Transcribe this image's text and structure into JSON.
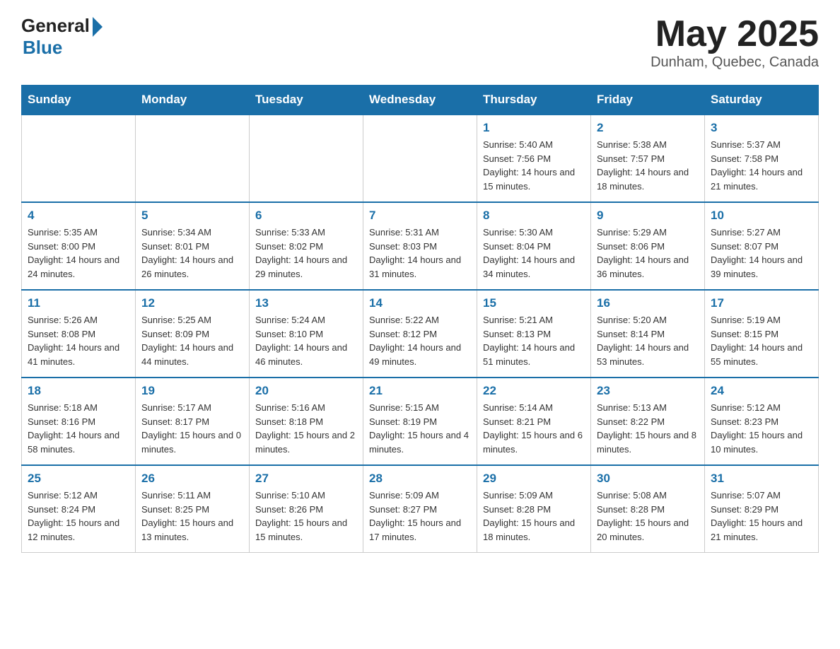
{
  "header": {
    "logo_general": "General",
    "logo_blue": "Blue",
    "title": "May 2025",
    "location": "Dunham, Quebec, Canada"
  },
  "weekdays": [
    "Sunday",
    "Monday",
    "Tuesday",
    "Wednesday",
    "Thursday",
    "Friday",
    "Saturday"
  ],
  "weeks": [
    [
      {
        "day": "",
        "info": ""
      },
      {
        "day": "",
        "info": ""
      },
      {
        "day": "",
        "info": ""
      },
      {
        "day": "",
        "info": ""
      },
      {
        "day": "1",
        "info": "Sunrise: 5:40 AM\nSunset: 7:56 PM\nDaylight: 14 hours and 15 minutes."
      },
      {
        "day": "2",
        "info": "Sunrise: 5:38 AM\nSunset: 7:57 PM\nDaylight: 14 hours and 18 minutes."
      },
      {
        "day": "3",
        "info": "Sunrise: 5:37 AM\nSunset: 7:58 PM\nDaylight: 14 hours and 21 minutes."
      }
    ],
    [
      {
        "day": "4",
        "info": "Sunrise: 5:35 AM\nSunset: 8:00 PM\nDaylight: 14 hours and 24 minutes."
      },
      {
        "day": "5",
        "info": "Sunrise: 5:34 AM\nSunset: 8:01 PM\nDaylight: 14 hours and 26 minutes."
      },
      {
        "day": "6",
        "info": "Sunrise: 5:33 AM\nSunset: 8:02 PM\nDaylight: 14 hours and 29 minutes."
      },
      {
        "day": "7",
        "info": "Sunrise: 5:31 AM\nSunset: 8:03 PM\nDaylight: 14 hours and 31 minutes."
      },
      {
        "day": "8",
        "info": "Sunrise: 5:30 AM\nSunset: 8:04 PM\nDaylight: 14 hours and 34 minutes."
      },
      {
        "day": "9",
        "info": "Sunrise: 5:29 AM\nSunset: 8:06 PM\nDaylight: 14 hours and 36 minutes."
      },
      {
        "day": "10",
        "info": "Sunrise: 5:27 AM\nSunset: 8:07 PM\nDaylight: 14 hours and 39 minutes."
      }
    ],
    [
      {
        "day": "11",
        "info": "Sunrise: 5:26 AM\nSunset: 8:08 PM\nDaylight: 14 hours and 41 minutes."
      },
      {
        "day": "12",
        "info": "Sunrise: 5:25 AM\nSunset: 8:09 PM\nDaylight: 14 hours and 44 minutes."
      },
      {
        "day": "13",
        "info": "Sunrise: 5:24 AM\nSunset: 8:10 PM\nDaylight: 14 hours and 46 minutes."
      },
      {
        "day": "14",
        "info": "Sunrise: 5:22 AM\nSunset: 8:12 PM\nDaylight: 14 hours and 49 minutes."
      },
      {
        "day": "15",
        "info": "Sunrise: 5:21 AM\nSunset: 8:13 PM\nDaylight: 14 hours and 51 minutes."
      },
      {
        "day": "16",
        "info": "Sunrise: 5:20 AM\nSunset: 8:14 PM\nDaylight: 14 hours and 53 minutes."
      },
      {
        "day": "17",
        "info": "Sunrise: 5:19 AM\nSunset: 8:15 PM\nDaylight: 14 hours and 55 minutes."
      }
    ],
    [
      {
        "day": "18",
        "info": "Sunrise: 5:18 AM\nSunset: 8:16 PM\nDaylight: 14 hours and 58 minutes."
      },
      {
        "day": "19",
        "info": "Sunrise: 5:17 AM\nSunset: 8:17 PM\nDaylight: 15 hours and 0 minutes."
      },
      {
        "day": "20",
        "info": "Sunrise: 5:16 AM\nSunset: 8:18 PM\nDaylight: 15 hours and 2 minutes."
      },
      {
        "day": "21",
        "info": "Sunrise: 5:15 AM\nSunset: 8:19 PM\nDaylight: 15 hours and 4 minutes."
      },
      {
        "day": "22",
        "info": "Sunrise: 5:14 AM\nSunset: 8:21 PM\nDaylight: 15 hours and 6 minutes."
      },
      {
        "day": "23",
        "info": "Sunrise: 5:13 AM\nSunset: 8:22 PM\nDaylight: 15 hours and 8 minutes."
      },
      {
        "day": "24",
        "info": "Sunrise: 5:12 AM\nSunset: 8:23 PM\nDaylight: 15 hours and 10 minutes."
      }
    ],
    [
      {
        "day": "25",
        "info": "Sunrise: 5:12 AM\nSunset: 8:24 PM\nDaylight: 15 hours and 12 minutes."
      },
      {
        "day": "26",
        "info": "Sunrise: 5:11 AM\nSunset: 8:25 PM\nDaylight: 15 hours and 13 minutes."
      },
      {
        "day": "27",
        "info": "Sunrise: 5:10 AM\nSunset: 8:26 PM\nDaylight: 15 hours and 15 minutes."
      },
      {
        "day": "28",
        "info": "Sunrise: 5:09 AM\nSunset: 8:27 PM\nDaylight: 15 hours and 17 minutes."
      },
      {
        "day": "29",
        "info": "Sunrise: 5:09 AM\nSunset: 8:28 PM\nDaylight: 15 hours and 18 minutes."
      },
      {
        "day": "30",
        "info": "Sunrise: 5:08 AM\nSunset: 8:28 PM\nDaylight: 15 hours and 20 minutes."
      },
      {
        "day": "31",
        "info": "Sunrise: 5:07 AM\nSunset: 8:29 PM\nDaylight: 15 hours and 21 minutes."
      }
    ]
  ]
}
